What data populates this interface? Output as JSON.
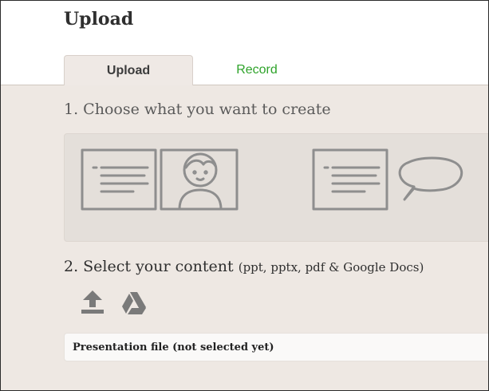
{
  "header": {
    "title": "Upload"
  },
  "tabs": [
    {
      "label": "Upload",
      "active": true
    },
    {
      "label": "Record",
      "active": false
    }
  ],
  "steps": {
    "choose": {
      "label": "1. Choose what you want to create"
    },
    "select": {
      "label": "2. Select your content",
      "hint": "(ppt, pptx, pdf & Google Docs)"
    }
  },
  "options": [
    {
      "icon": "slides-with-presenter-icon"
    },
    {
      "icon": "slides-with-comments-icon"
    }
  ],
  "sources": [
    {
      "icon": "upload-icon"
    },
    {
      "icon": "google-drive-icon"
    }
  ],
  "file": {
    "label": "Presentation file (not selected yet)"
  },
  "colors": {
    "accent": "#2ea32a",
    "panel": "#eee8e3",
    "sketch": "#8e8e8e"
  }
}
